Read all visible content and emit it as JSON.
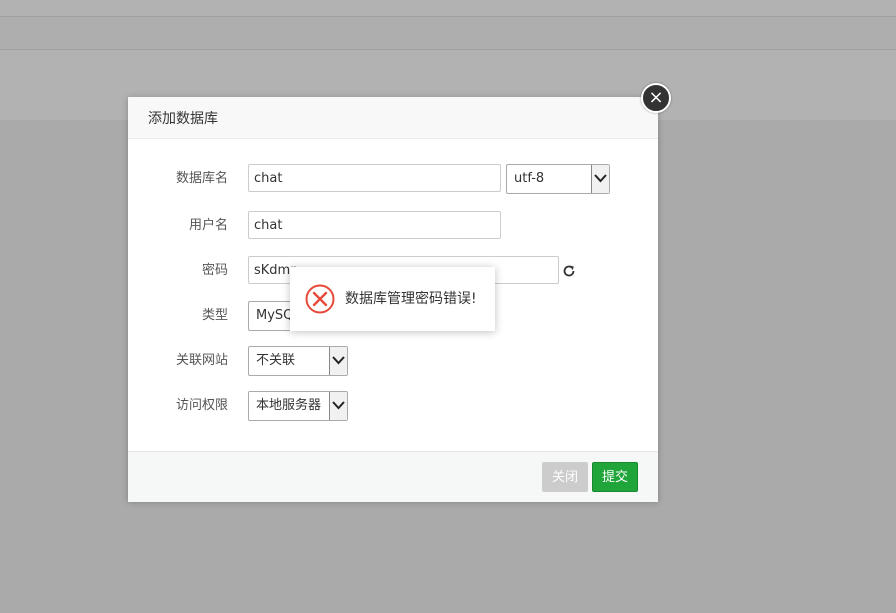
{
  "modal": {
    "title": "添加数据库",
    "close_symbol": "×",
    "fields": {
      "db_name": {
        "label": "数据库名",
        "value": "chat"
      },
      "charset": {
        "value": "utf-8"
      },
      "username": {
        "label": "用户名",
        "value": "chat"
      },
      "password": {
        "label": "密码",
        "value": "sKdmr"
      },
      "type": {
        "label": "类型",
        "value": "MySQ"
      },
      "site": {
        "label": "关联网站",
        "value": "不关联"
      },
      "access": {
        "label": "访问权限",
        "value": "本地服务器"
      }
    },
    "buttons": {
      "close": "关闭",
      "submit": "提交"
    }
  },
  "toast": {
    "message": "数据库管理密码错误!"
  },
  "colors": {
    "submit": "#20a53a",
    "error": "#e64a3b"
  },
  "icons": [
    "close-icon",
    "chevron-down-icon",
    "refresh-icon",
    "error-icon"
  ]
}
